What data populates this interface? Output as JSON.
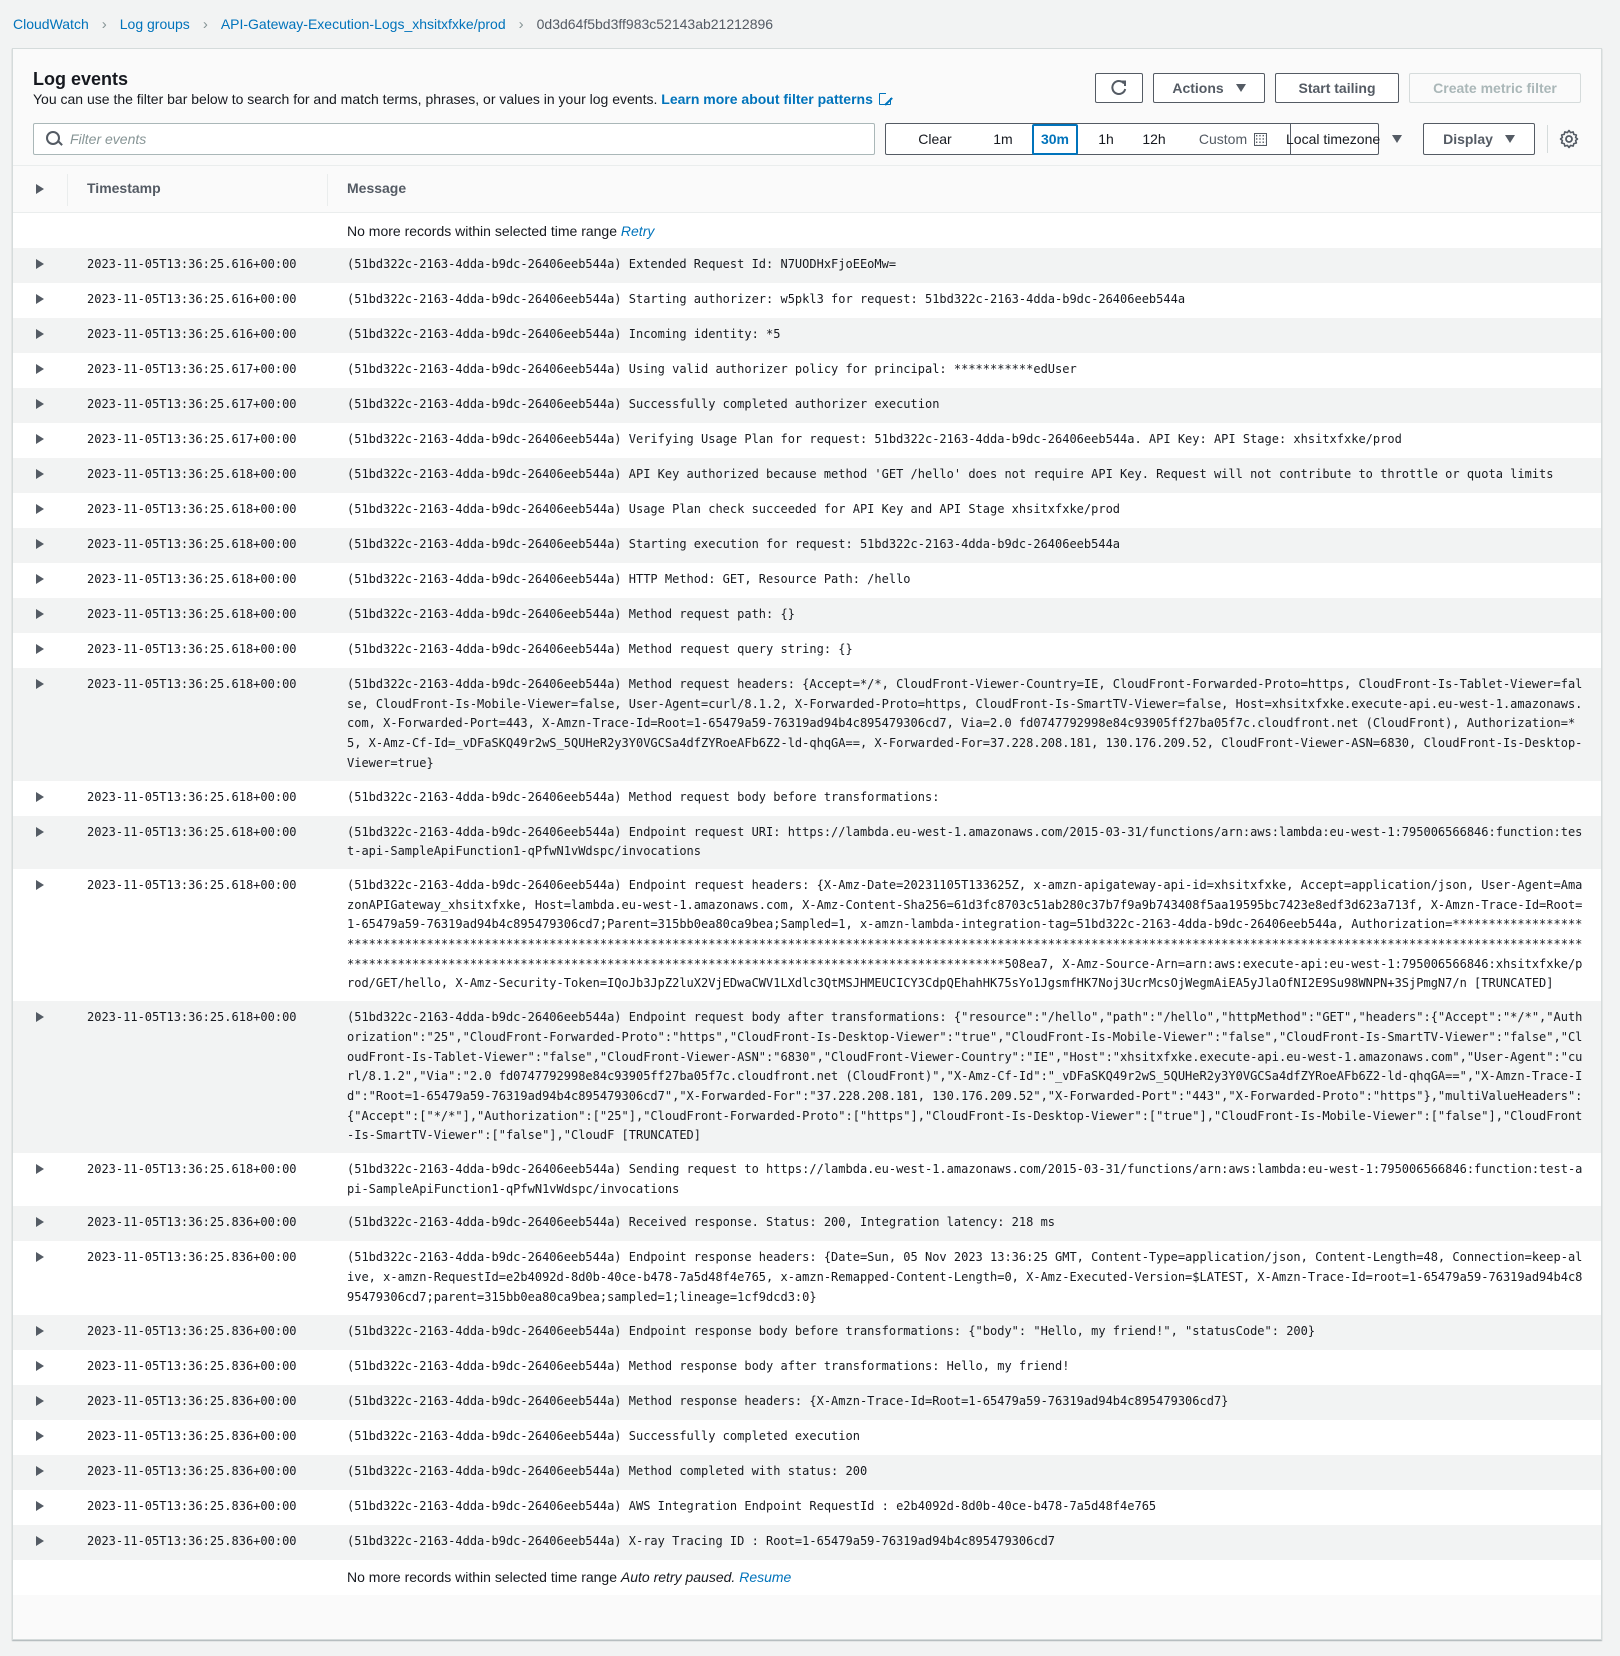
{
  "breadcrumb": [
    {
      "label": "CloudWatch",
      "link": true
    },
    {
      "label": "Log groups",
      "link": true
    },
    {
      "label": "API-Gateway-Execution-Logs_xhsitxfxke/prod",
      "link": true
    },
    {
      "label": "0d3d64f5bd3ff983c52143ab21212896",
      "link": false
    }
  ],
  "header": {
    "title": "Log events",
    "description": "You can use the filter bar below to search for and match terms, phrases, or values in your log events.",
    "learn_more": "Learn more about filter patterns"
  },
  "toolbar": {
    "actions_label": "Actions",
    "start_tailing_label": "Start tailing",
    "create_metric_filter_label": "Create metric filter"
  },
  "filter": {
    "placeholder": "Filter events",
    "value": ""
  },
  "time_range": {
    "options": [
      "Clear",
      "1m",
      "30m",
      "1h",
      "12h",
      "Custom"
    ],
    "selected": "30m",
    "timezone": "Local timezone",
    "display_label": "Display"
  },
  "table": {
    "columns": [
      "Timestamp",
      "Message"
    ],
    "top_status": {
      "text": "No more records within selected time range",
      "link": "Retry"
    },
    "bottom_status": {
      "text": "No more records within selected time range",
      "note": "Auto retry paused.",
      "link": "Resume"
    },
    "rows": [
      {
        "timestamp": "2023-11-05T13:36:25.616+00:00",
        "message": "(51bd322c-2163-4dda-b9dc-26406eeb544a) Extended Request Id: N7UODHxFjoEEoMw="
      },
      {
        "timestamp": "2023-11-05T13:36:25.616+00:00",
        "message": "(51bd322c-2163-4dda-b9dc-26406eeb544a) Starting authorizer: w5pkl3 for request: 51bd322c-2163-4dda-b9dc-26406eeb544a"
      },
      {
        "timestamp": "2023-11-05T13:36:25.616+00:00",
        "message": "(51bd322c-2163-4dda-b9dc-26406eeb544a) Incoming identity: *5"
      },
      {
        "timestamp": "2023-11-05T13:36:25.617+00:00",
        "message": "(51bd322c-2163-4dda-b9dc-26406eeb544a) Using valid authorizer policy for principal: ***********edUser"
      },
      {
        "timestamp": "2023-11-05T13:36:25.617+00:00",
        "message": "(51bd322c-2163-4dda-b9dc-26406eeb544a) Successfully completed authorizer execution"
      },
      {
        "timestamp": "2023-11-05T13:36:25.617+00:00",
        "message": "(51bd322c-2163-4dda-b9dc-26406eeb544a) Verifying Usage Plan for request: 51bd322c-2163-4dda-b9dc-26406eeb544a. API Key: API Stage: xhsitxfxke/prod"
      },
      {
        "timestamp": "2023-11-05T13:36:25.618+00:00",
        "message": "(51bd322c-2163-4dda-b9dc-26406eeb544a) API Key authorized because method 'GET /hello' does not require API Key. Request will not contribute to throttle or quota limits"
      },
      {
        "timestamp": "2023-11-05T13:36:25.618+00:00",
        "message": "(51bd322c-2163-4dda-b9dc-26406eeb544a) Usage Plan check succeeded for API Key and API Stage xhsitxfxke/prod"
      },
      {
        "timestamp": "2023-11-05T13:36:25.618+00:00",
        "message": "(51bd322c-2163-4dda-b9dc-26406eeb544a) Starting execution for request: 51bd322c-2163-4dda-b9dc-26406eeb544a"
      },
      {
        "timestamp": "2023-11-05T13:36:25.618+00:00",
        "message": "(51bd322c-2163-4dda-b9dc-26406eeb544a) HTTP Method: GET, Resource Path: /hello"
      },
      {
        "timestamp": "2023-11-05T13:36:25.618+00:00",
        "message": "(51bd322c-2163-4dda-b9dc-26406eeb544a) Method request path: {}"
      },
      {
        "timestamp": "2023-11-05T13:36:25.618+00:00",
        "message": "(51bd322c-2163-4dda-b9dc-26406eeb544a) Method request query string: {}"
      },
      {
        "timestamp": "2023-11-05T13:36:25.618+00:00",
        "message": "(51bd322c-2163-4dda-b9dc-26406eeb544a) Method request headers: {Accept=*/*, CloudFront-Viewer-Country=IE, CloudFront-Forwarded-Proto=https, CloudFront-Is-Tablet-Viewer=false, CloudFront-Is-Mobile-Viewer=false, User-Agent=curl/8.1.2, X-Forwarded-Proto=https, CloudFront-Is-SmartTV-Viewer=false, Host=xhsitxfxke.execute-api.eu-west-1.amazonaws.com, X-Forwarded-Port=443, X-Amzn-Trace-Id=Root=1-65479a59-76319ad94b4c895479306cd7, Via=2.0 fd0747792998e84c93905ff27ba05f7c.cloudfront.net (CloudFront), Authorization=*5, X-Amz-Cf-Id=_vDFaSKQ49r2wS_5QUHeR2y3Y0VGCSa4dfZYRoeAFb6Z2-ld-qhqGA==, X-Forwarded-For=37.228.208.181, 130.176.209.52, CloudFront-Viewer-ASN=6830, CloudFront-Is-Desktop-Viewer=true}"
      },
      {
        "timestamp": "2023-11-05T13:36:25.618+00:00",
        "message": "(51bd322c-2163-4dda-b9dc-26406eeb544a) Method request body before transformations:"
      },
      {
        "timestamp": "2023-11-05T13:36:25.618+00:00",
        "message": "(51bd322c-2163-4dda-b9dc-26406eeb544a) Endpoint request URI: https://lambda.eu-west-1.amazonaws.com/2015-03-31/functions/arn:aws:lambda:eu-west-1:795006566846:function:test-api-SampleApiFunction1-qPfwN1vWdspc/invocations"
      },
      {
        "timestamp": "2023-11-05T13:36:25.618+00:00",
        "message": "(51bd322c-2163-4dda-b9dc-26406eeb544a) Endpoint request headers: {X-Amz-Date=20231105T133625Z, x-amzn-apigateway-api-id=xhsitxfxke, Accept=application/json, User-Agent=AmazonAPIGateway_xhsitxfxke, Host=lambda.eu-west-1.amazonaws.com, X-Amz-Content-Sha256=61d3fc8703c51ab280c37b7f9a9b743408f5aa19595bc7423e8edf3d623a713f, X-Amzn-Trace-Id=Root=1-65479a59-76319ad94b4c895479306cd7;Parent=315bb0ea80ca9bea;Sampled=1, x-amzn-lambda-integration-tag=51bd322c-2163-4dda-b9dc-26406eeb544a, Authorization=****************************************************************************************************************************************************************************************************************************************************************************************508ea7, X-Amz-Source-Arn=arn:aws:execute-api:eu-west-1:795006566846:xhsitxfxke/prod/GET/hello, X-Amz-Security-Token=IQoJb3JpZ2luX2VjEDwaCWV1LXdlc3QtMSJHMEUCICY3CdpQEhahHK75sYo1JgsmfHK7Noj3UcrMcsOjWegmAiEA5yJlaOfNI2E9Su98WNPN+3SjPmgN7/n [TRUNCATED]"
      },
      {
        "timestamp": "2023-11-05T13:36:25.618+00:00",
        "message": "(51bd322c-2163-4dda-b9dc-26406eeb544a) Endpoint request body after transformations: {\"resource\":\"/hello\",\"path\":\"/hello\",\"httpMethod\":\"GET\",\"headers\":{\"Accept\":\"*/*\",\"Authorization\":\"25\",\"CloudFront-Forwarded-Proto\":\"https\",\"CloudFront-Is-Desktop-Viewer\":\"true\",\"CloudFront-Is-Mobile-Viewer\":\"false\",\"CloudFront-Is-SmartTV-Viewer\":\"false\",\"CloudFront-Is-Tablet-Viewer\":\"false\",\"CloudFront-Viewer-ASN\":\"6830\",\"CloudFront-Viewer-Country\":\"IE\",\"Host\":\"xhsitxfxke.execute-api.eu-west-1.amazonaws.com\",\"User-Agent\":\"curl/8.1.2\",\"Via\":\"2.0 fd0747792998e84c93905ff27ba05f7c.cloudfront.net (CloudFront)\",\"X-Amz-Cf-Id\":\"_vDFaSKQ49r2wS_5QUHeR2y3Y0VGCSa4dfZYRoeAFb6Z2-ld-qhqGA==\",\"X-Amzn-Trace-Id\":\"Root=1-65479a59-76319ad94b4c895479306cd7\",\"X-Forwarded-For\":\"37.228.208.181, 130.176.209.52\",\"X-Forwarded-Port\":\"443\",\"X-Forwarded-Proto\":\"https\"},\"multiValueHeaders\":{\"Accept\":[\"*/*\"],\"Authorization\":[\"25\"],\"CloudFront-Forwarded-Proto\":[\"https\"],\"CloudFront-Is-Desktop-Viewer\":[\"true\"],\"CloudFront-Is-Mobile-Viewer\":[\"false\"],\"CloudFront-Is-SmartTV-Viewer\":[\"false\"],\"CloudF [TRUNCATED]"
      },
      {
        "timestamp": "2023-11-05T13:36:25.618+00:00",
        "message": "(51bd322c-2163-4dda-b9dc-26406eeb544a) Sending request to https://lambda.eu-west-1.amazonaws.com/2015-03-31/functions/arn:aws:lambda:eu-west-1:795006566846:function:test-api-SampleApiFunction1-qPfwN1vWdspc/invocations"
      },
      {
        "timestamp": "2023-11-05T13:36:25.836+00:00",
        "message": "(51bd322c-2163-4dda-b9dc-26406eeb544a) Received response. Status: 200, Integration latency: 218 ms"
      },
      {
        "timestamp": "2023-11-05T13:36:25.836+00:00",
        "message": "(51bd322c-2163-4dda-b9dc-26406eeb544a) Endpoint response headers: {Date=Sun, 05 Nov 2023 13:36:25 GMT, Content-Type=application/json, Content-Length=48, Connection=keep-alive, x-amzn-RequestId=e2b4092d-8d0b-40ce-b478-7a5d48f4e765, x-amzn-Remapped-Content-Length=0, X-Amz-Executed-Version=$LATEST, X-Amzn-Trace-Id=root=1-65479a59-76319ad94b4c895479306cd7;parent=315bb0ea80ca9bea;sampled=1;lineage=1cf9dcd3:0}"
      },
      {
        "timestamp": "2023-11-05T13:36:25.836+00:00",
        "message": "(51bd322c-2163-4dda-b9dc-26406eeb544a) Endpoint response body before transformations: {\"body\": \"Hello, my friend!\", \"statusCode\": 200}"
      },
      {
        "timestamp": "2023-11-05T13:36:25.836+00:00",
        "message": "(51bd322c-2163-4dda-b9dc-26406eeb544a) Method response body after transformations: Hello, my friend!"
      },
      {
        "timestamp": "2023-11-05T13:36:25.836+00:00",
        "message": "(51bd322c-2163-4dda-b9dc-26406eeb544a) Method response headers: {X-Amzn-Trace-Id=Root=1-65479a59-76319ad94b4c895479306cd7}"
      },
      {
        "timestamp": "2023-11-05T13:36:25.836+00:00",
        "message": "(51bd322c-2163-4dda-b9dc-26406eeb544a) Successfully completed execution"
      },
      {
        "timestamp": "2023-11-05T13:36:25.836+00:00",
        "message": "(51bd322c-2163-4dda-b9dc-26406eeb544a) Method completed with status: 200"
      },
      {
        "timestamp": "2023-11-05T13:36:25.836+00:00",
        "message": "(51bd322c-2163-4dda-b9dc-26406eeb544a) AWS Integration Endpoint RequestId : e2b4092d-8d0b-40ce-b478-7a5d48f4e765"
      },
      {
        "timestamp": "2023-11-05T13:36:25.836+00:00",
        "message": "(51bd322c-2163-4dda-b9dc-26406eeb544a) X-ray Tracing ID : Root=1-65479a59-76319ad94b4c895479306cd7"
      }
    ]
  },
  "colors": {
    "link": "#0073bb",
    "selected_range": "#0073bb",
    "row_alt": "#f2f3f3",
    "page_bg": "#f2f3f3"
  }
}
